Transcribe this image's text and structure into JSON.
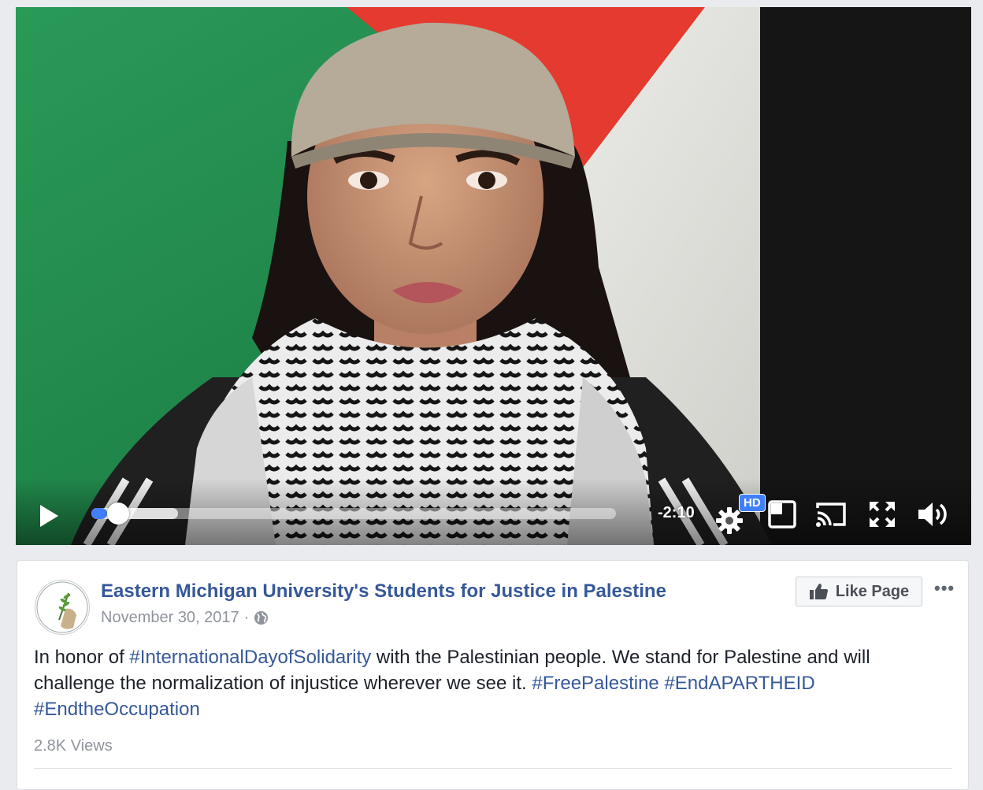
{
  "video": {
    "time_remaining": "-2:10",
    "quality_badge": "HD",
    "progress_fraction": 0.03,
    "buffered_fraction": 0.165
  },
  "post": {
    "page_name": "Eastern Michigan University's Students for Justice in Palestine",
    "date": "November 30, 2017",
    "separator": "·",
    "like_label": "Like Page",
    "more_label": "•••",
    "text_segments": [
      {
        "t": "In honor of ",
        "tag": false
      },
      {
        "t": "#InternationalDayofSolidarity",
        "tag": true
      },
      {
        "t": " with the Palestinian people. We stand for Palestine and will challenge the normalization of injustice wherever we see it. ",
        "tag": false
      },
      {
        "t": "#FreePalestine",
        "tag": true
      },
      {
        "t": " ",
        "tag": false
      },
      {
        "t": "#EndAPARTHEID",
        "tag": true
      },
      {
        "t": " ",
        "tag": false
      },
      {
        "t": "#EndtheOccupation",
        "tag": true
      }
    ],
    "views": "2.8K Views"
  },
  "colors": {
    "link": "#365899",
    "accent": "#4080ff",
    "flag_green": "#1f8a4c",
    "flag_red": "#e53a2f",
    "flag_black": "#151515"
  }
}
